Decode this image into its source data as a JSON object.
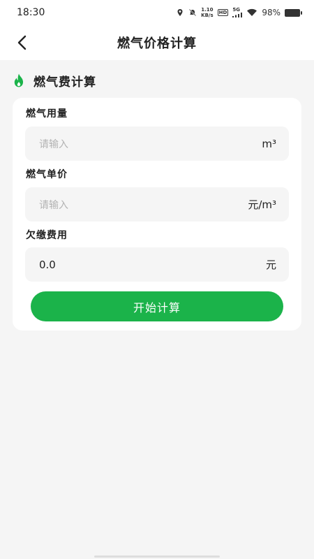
{
  "status_bar": {
    "time": "18:30",
    "net_speed_value": "1.10",
    "net_speed_unit": "KB/s",
    "hd_badge": "HD",
    "signal_label": "5G",
    "battery": "98%"
  },
  "header": {
    "title": "燃气价格计算",
    "back_icon": "chevron-left-icon"
  },
  "section": {
    "title": "燃气费计算",
    "icon": "flame-icon",
    "icon_color": "#1bb34a"
  },
  "form": {
    "fields": [
      {
        "label": "燃气用量",
        "placeholder": "请输入",
        "value": "",
        "unit": "m³"
      },
      {
        "label": "燃气单价",
        "placeholder": "请输入",
        "value": "",
        "unit": "元/m³"
      },
      {
        "label": "欠缴费用",
        "placeholder": "",
        "value": "0.0",
        "unit": "元"
      }
    ],
    "submit_label": "开始计算"
  },
  "colors": {
    "accent": "#1bb34a",
    "background": "#f5f5f5",
    "card": "#ffffff",
    "placeholder": "#b3b3b3"
  }
}
